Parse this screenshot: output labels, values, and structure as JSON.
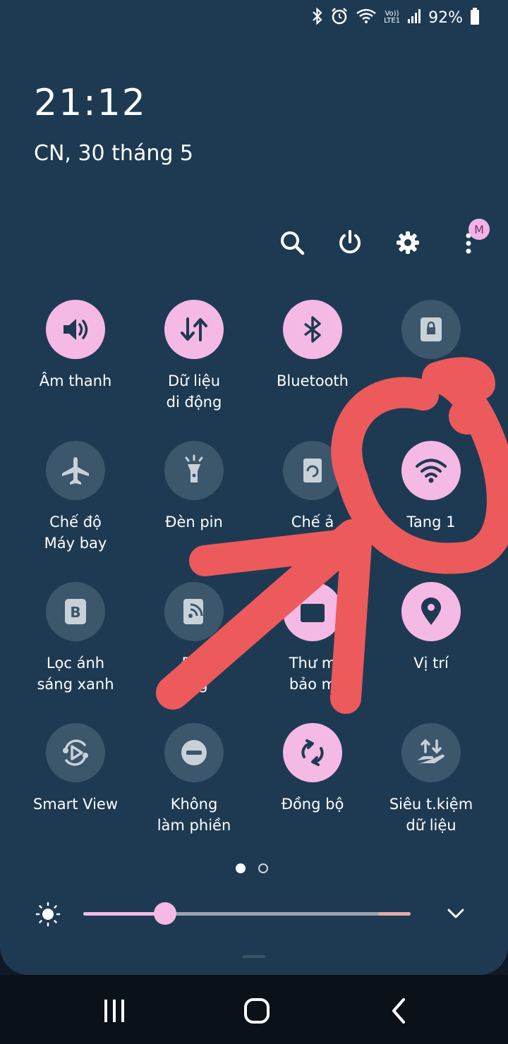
{
  "status_bar": {
    "volte_label": "Vo))",
    "lte_label": "LTE1",
    "battery": "92%",
    "icons": [
      "bluetooth-icon",
      "alarm-icon",
      "wifi-icon",
      "signal-icon",
      "battery-icon"
    ]
  },
  "clock": {
    "time": "21:12",
    "date": "CN, 30 tháng 5"
  },
  "header_actions": {
    "icons": [
      "search-icon",
      "power-icon",
      "settings-icon",
      "more-icon"
    ],
    "profile_badge": "M"
  },
  "tiles": [
    {
      "id": "sound",
      "label": "Âm thanh",
      "icon": "volume-icon",
      "active": true
    },
    {
      "id": "mobile-data",
      "label": "Dữ liệu\ndi động",
      "icon": "data-arrows-icon",
      "active": true
    },
    {
      "id": "bluetooth",
      "label": "Bluetooth",
      "icon": "bluetooth-icon",
      "active": true
    },
    {
      "id": "secure",
      "label": "",
      "icon": "lock-icon",
      "active": false
    },
    {
      "id": "airplane",
      "label": "Chế độ\nMáy bay",
      "icon": "airplane-icon",
      "active": false
    },
    {
      "id": "flashlight",
      "label": "Đèn pin",
      "icon": "flashlight-icon",
      "active": false
    },
    {
      "id": "rotate",
      "label": "Chế ả",
      "icon": "rotate-icon",
      "active": false
    },
    {
      "id": "wifi",
      "label": "Tang 1",
      "icon": "wifi-icon",
      "active": true
    },
    {
      "id": "blue-light",
      "label": "Lọc ánh\nsáng xanh",
      "icon": "blue-light-filter-icon",
      "active": false
    },
    {
      "id": "hotspot",
      "label": "Điể\nộng",
      "icon": "hotspot-icon",
      "active": false
    },
    {
      "id": "secure-folder",
      "label": "Thư m\nbảo m",
      "icon": "folder-icon",
      "active": true
    },
    {
      "id": "location",
      "label": "Vị trí",
      "icon": "location-pin-icon",
      "active": true
    },
    {
      "id": "smart-view",
      "label": "Smart View",
      "icon": "smart-view-icon",
      "active": false
    },
    {
      "id": "dnd",
      "label": "Không\nlàm phiền",
      "icon": "do-not-disturb-icon",
      "active": false
    },
    {
      "id": "sync",
      "label": "Đồng bộ",
      "icon": "sync-icon",
      "active": true
    },
    {
      "id": "data-saver",
      "label": "Siêu t.kiệm\ndữ liệu",
      "icon": "data-saver-icon",
      "active": false
    }
  ],
  "pager": {
    "pages": 2,
    "current": 1
  },
  "brightness": {
    "level": 0.25,
    "icon": "brightness-icon",
    "expand_icon": "chevron-down-icon"
  },
  "nav_bar": {
    "icons": [
      "recents-icon",
      "home-icon",
      "back-icon"
    ]
  },
  "colors": {
    "panel": "#1e3a52",
    "tile_on": "#f4b9e4",
    "tile_off": "#3c566c",
    "annotation": "#ec5a5c"
  }
}
